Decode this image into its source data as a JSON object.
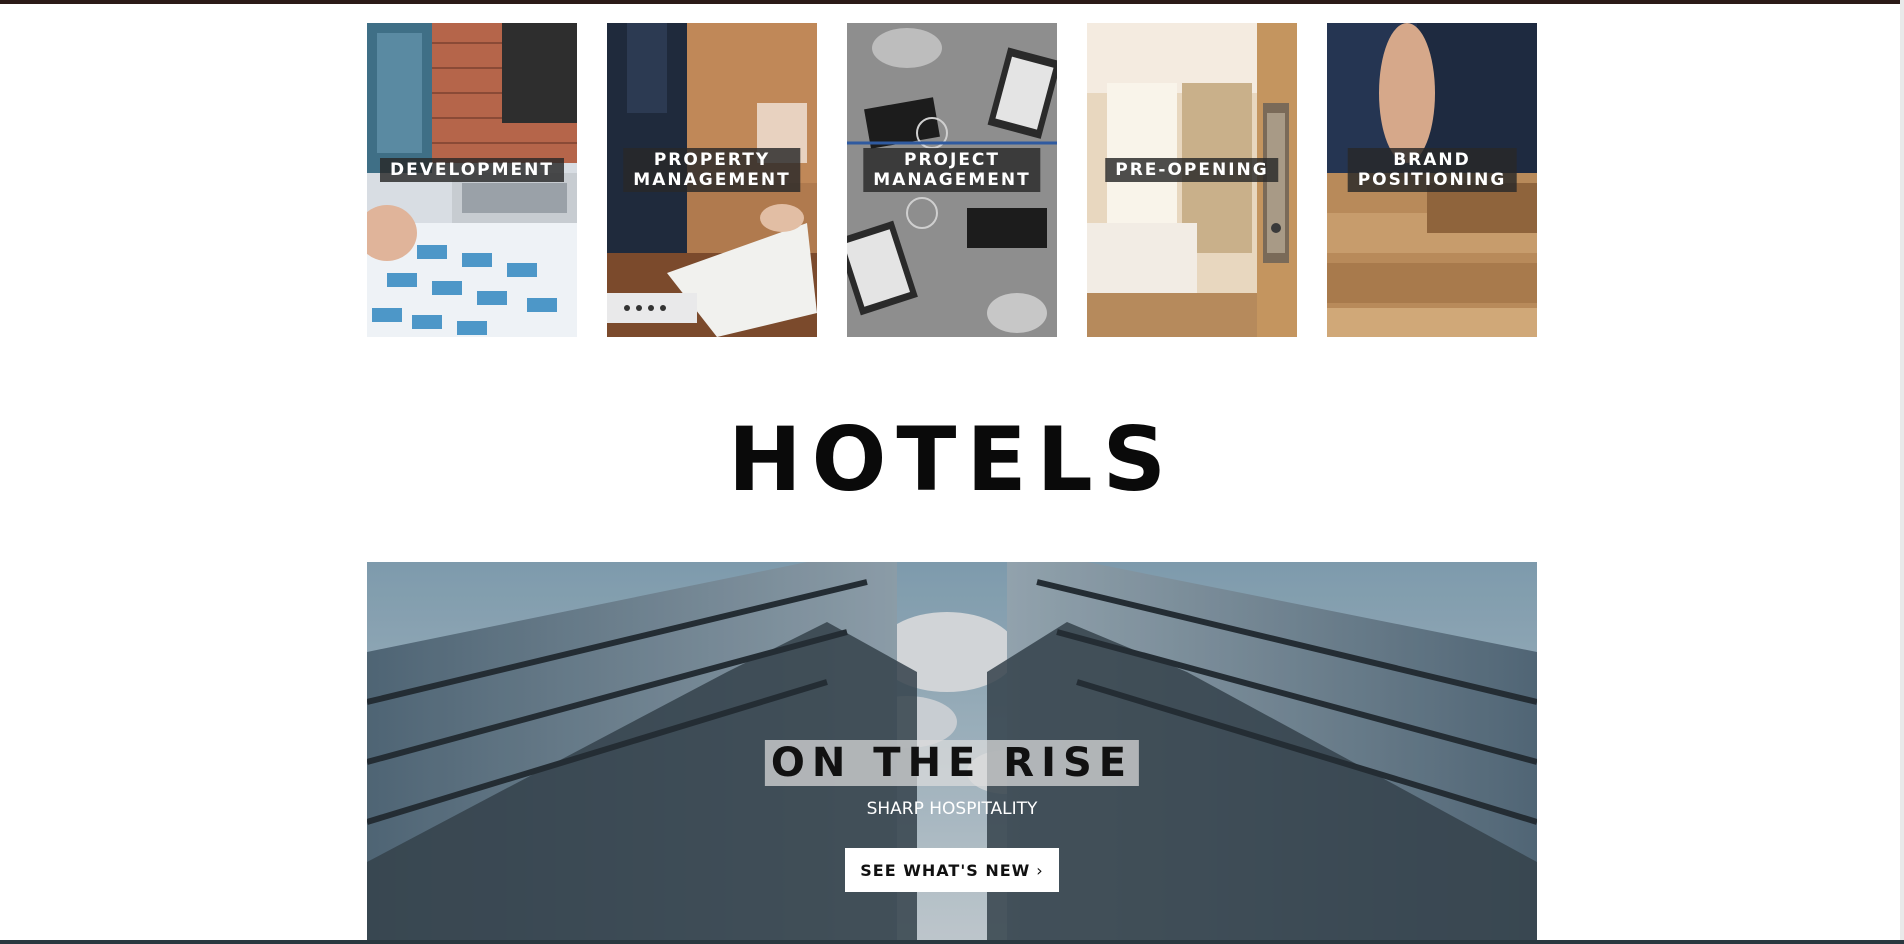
{
  "services": [
    {
      "lines": [
        "DEVELOPMENT"
      ]
    },
    {
      "lines": [
        "PROPERTY",
        "MANAGEMENT"
      ]
    },
    {
      "lines": [
        "PROJECT",
        "MANAGEMENT"
      ]
    },
    {
      "lines": [
        "PRE-OPENING"
      ]
    },
    {
      "lines": [
        "BRAND",
        "POSITIONING"
      ]
    }
  ],
  "section": {
    "title": "HOTELS"
  },
  "hero": {
    "title": "ON THE RISE",
    "subtitle": "SHARP HOSPITALITY",
    "button_label": "SEE WHAT'S NEW",
    "button_icon": "chevron-right-icon"
  },
  "colors": {
    "top_bar": "#2b1a18",
    "label_bg": "#282828",
    "heading": "#0a0a0a"
  }
}
